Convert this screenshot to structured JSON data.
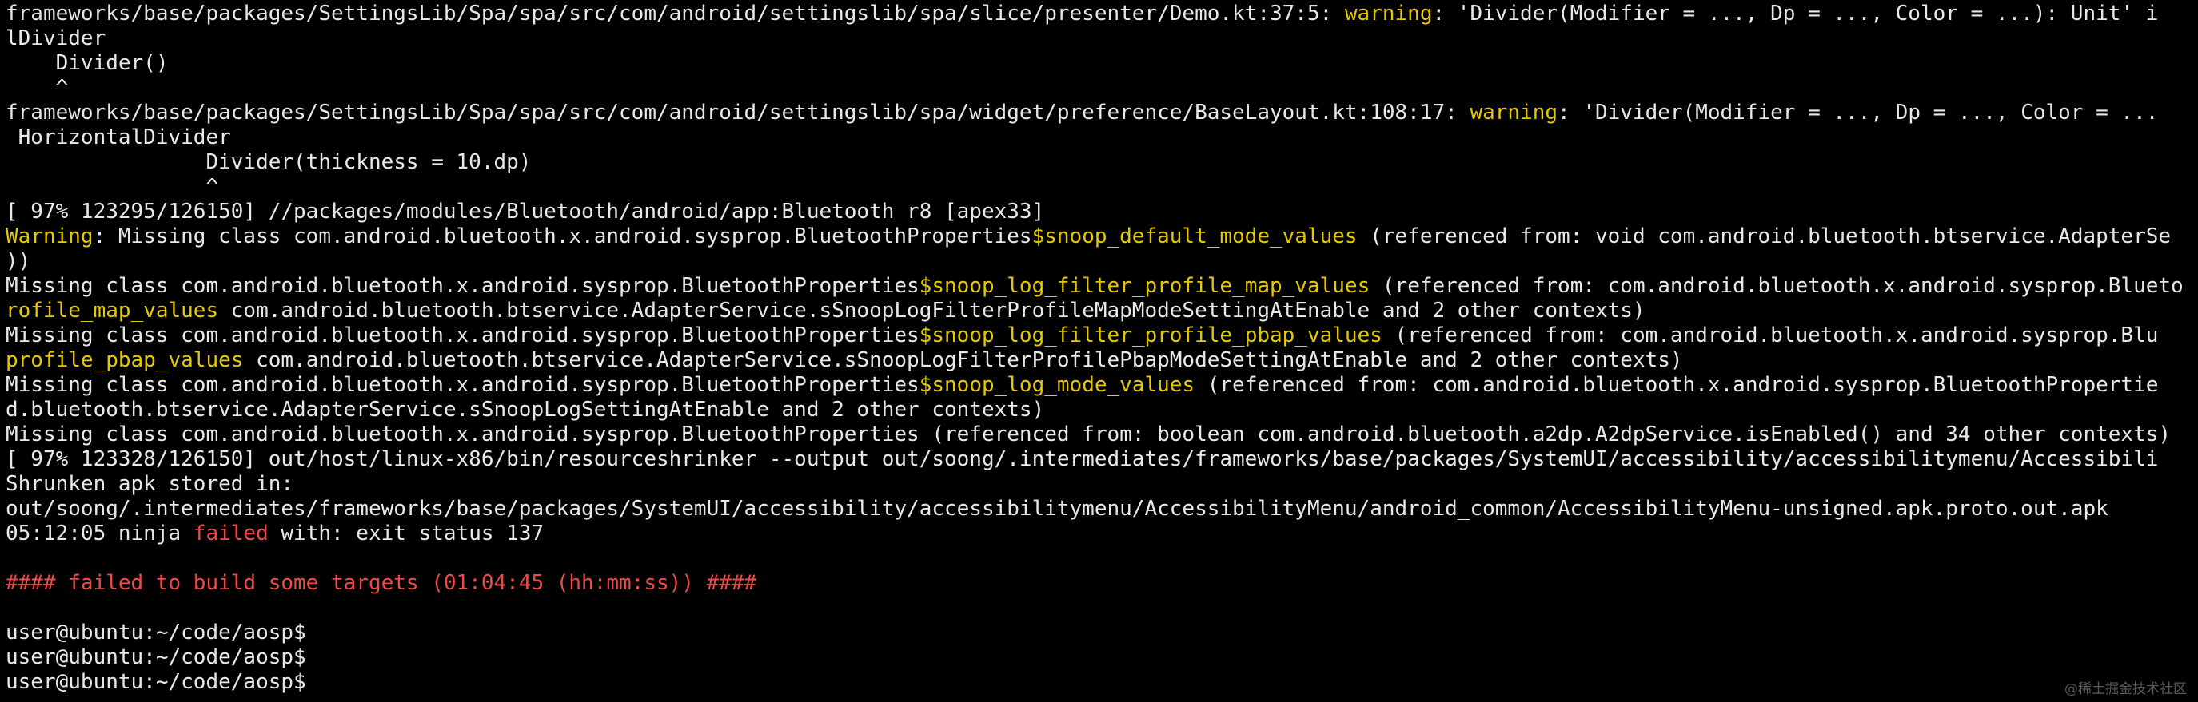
{
  "terminal": {
    "lines": [
      [
        {
          "t": "frameworks/base/packages/SettingsLib/Spa/spa/src/com/android/settingslib/spa/slice/presenter/Demo.kt:37:5: ",
          "c": "normal"
        },
        {
          "t": "warning",
          "c": "yellow"
        },
        {
          "t": ": 'Divider(Modifier = ..., Dp = ..., Color = ...): Unit' i",
          "c": "normal"
        }
      ],
      [
        {
          "t": "lDivider",
          "c": "normal"
        }
      ],
      [
        {
          "t": "    Divider()",
          "c": "normal"
        }
      ],
      [
        {
          "t": "    ^",
          "c": "normal"
        }
      ],
      [
        {
          "t": "frameworks/base/packages/SettingsLib/Spa/spa/src/com/android/settingslib/spa/widget/preference/BaseLayout.kt:108:17: ",
          "c": "normal"
        },
        {
          "t": "warning",
          "c": "yellow"
        },
        {
          "t": ": 'Divider(Modifier = ..., Dp = ..., Color = ...",
          "c": "normal"
        }
      ],
      [
        {
          "t": " HorizontalDivider",
          "c": "normal"
        }
      ],
      [
        {
          "t": "                Divider(thickness = 10.dp)",
          "c": "normal"
        }
      ],
      [
        {
          "t": "                ^",
          "c": "normal"
        }
      ],
      [
        {
          "t": "[ 97% 123295/126150] //packages/modules/Bluetooth/android/app:Bluetooth r8 [apex33]",
          "c": "normal"
        }
      ],
      [
        {
          "t": "Warning",
          "c": "yellow"
        },
        {
          "t": ": Missing class com.android.bluetooth.x.android.sysprop.BluetoothProperties",
          "c": "normal"
        },
        {
          "t": "$snoop_default_mode_values",
          "c": "yellow"
        },
        {
          "t": " (referenced from: void com.android.bluetooth.btservice.AdapterSe",
          "c": "normal"
        }
      ],
      [
        {
          "t": "))",
          "c": "normal"
        }
      ],
      [
        {
          "t": "Missing class com.android.bluetooth.x.android.sysprop.BluetoothProperties",
          "c": "normal"
        },
        {
          "t": "$snoop_log_filter_profile_map_values",
          "c": "yellow"
        },
        {
          "t": " (referenced from: com.android.bluetooth.x.android.sysprop.Blueto",
          "c": "normal"
        }
      ],
      [
        {
          "t": "rofile_map_values",
          "c": "yellow"
        },
        {
          "t": " com.android.bluetooth.btservice.AdapterService.sSnoopLogFilterProfileMapModeSettingAtEnable and 2 other contexts)",
          "c": "normal"
        }
      ],
      [
        {
          "t": "Missing class com.android.bluetooth.x.android.sysprop.BluetoothProperties",
          "c": "normal"
        },
        {
          "t": "$snoop_log_filter_profile_pbap_values",
          "c": "yellow"
        },
        {
          "t": " (referenced from: com.android.bluetooth.x.android.sysprop.Blu",
          "c": "normal"
        }
      ],
      [
        {
          "t": "profile_pbap_values",
          "c": "yellow"
        },
        {
          "t": " com.android.bluetooth.btservice.AdapterService.sSnoopLogFilterProfilePbapModeSettingAtEnable and 2 other contexts)",
          "c": "normal"
        }
      ],
      [
        {
          "t": "Missing class com.android.bluetooth.x.android.sysprop.BluetoothProperties",
          "c": "normal"
        },
        {
          "t": "$snoop_log_mode_values",
          "c": "yellow"
        },
        {
          "t": " (referenced from: com.android.bluetooth.x.android.sysprop.BluetoothPropertie",
          "c": "normal"
        }
      ],
      [
        {
          "t": "d.bluetooth.btservice.AdapterService.sSnoopLogSettingAtEnable and 2 other contexts)",
          "c": "normal"
        }
      ],
      [
        {
          "t": "Missing class com.android.bluetooth.x.android.sysprop.BluetoothProperties (referenced from: boolean com.android.bluetooth.a2dp.A2dpService.isEnabled() and 34 other contexts)",
          "c": "normal"
        }
      ],
      [
        {
          "t": "[ 97% 123328/126150] out/host/linux-x86/bin/resourceshrinker --output out/soong/.intermediates/frameworks/base/packages/SystemUI/accessibility/accessibilitymenu/Accessibili",
          "c": "normal"
        }
      ],
      [
        {
          "t": "Shrunken apk stored in:",
          "c": "normal"
        }
      ],
      [
        {
          "t": "out/soong/.intermediates/frameworks/base/packages/SystemUI/accessibility/accessibilitymenu/AccessibilityMenu/android_common/AccessibilityMenu-unsigned.apk.proto.out.apk",
          "c": "normal"
        }
      ],
      [
        {
          "t": "05:12:05 ninja ",
          "c": "normal"
        },
        {
          "t": "failed",
          "c": "red"
        },
        {
          "t": " with: exit status 137",
          "c": "normal"
        }
      ],
      [
        {
          "t": "",
          "c": "normal"
        }
      ],
      [
        {
          "t": "#### failed to build some targets (01:04:45 (hh:mm:ss)) ####",
          "c": "red"
        }
      ],
      [
        {
          "t": "",
          "c": "normal"
        }
      ],
      [
        {
          "t": "user@ubuntu:~/code/aosp$",
          "c": "normal"
        }
      ],
      [
        {
          "t": "user@ubuntu:~/code/aosp$",
          "c": "normal"
        }
      ],
      [
        {
          "t": "user@ubuntu:~/code/aosp$",
          "c": "normal"
        }
      ]
    ]
  },
  "watermark": {
    "text": "@稀土掘金技术社区"
  },
  "colors": {
    "background": "#000000",
    "text": "#e8e8e8",
    "warning_yellow": "#e5c900",
    "error_red": "#ef4a4a"
  }
}
